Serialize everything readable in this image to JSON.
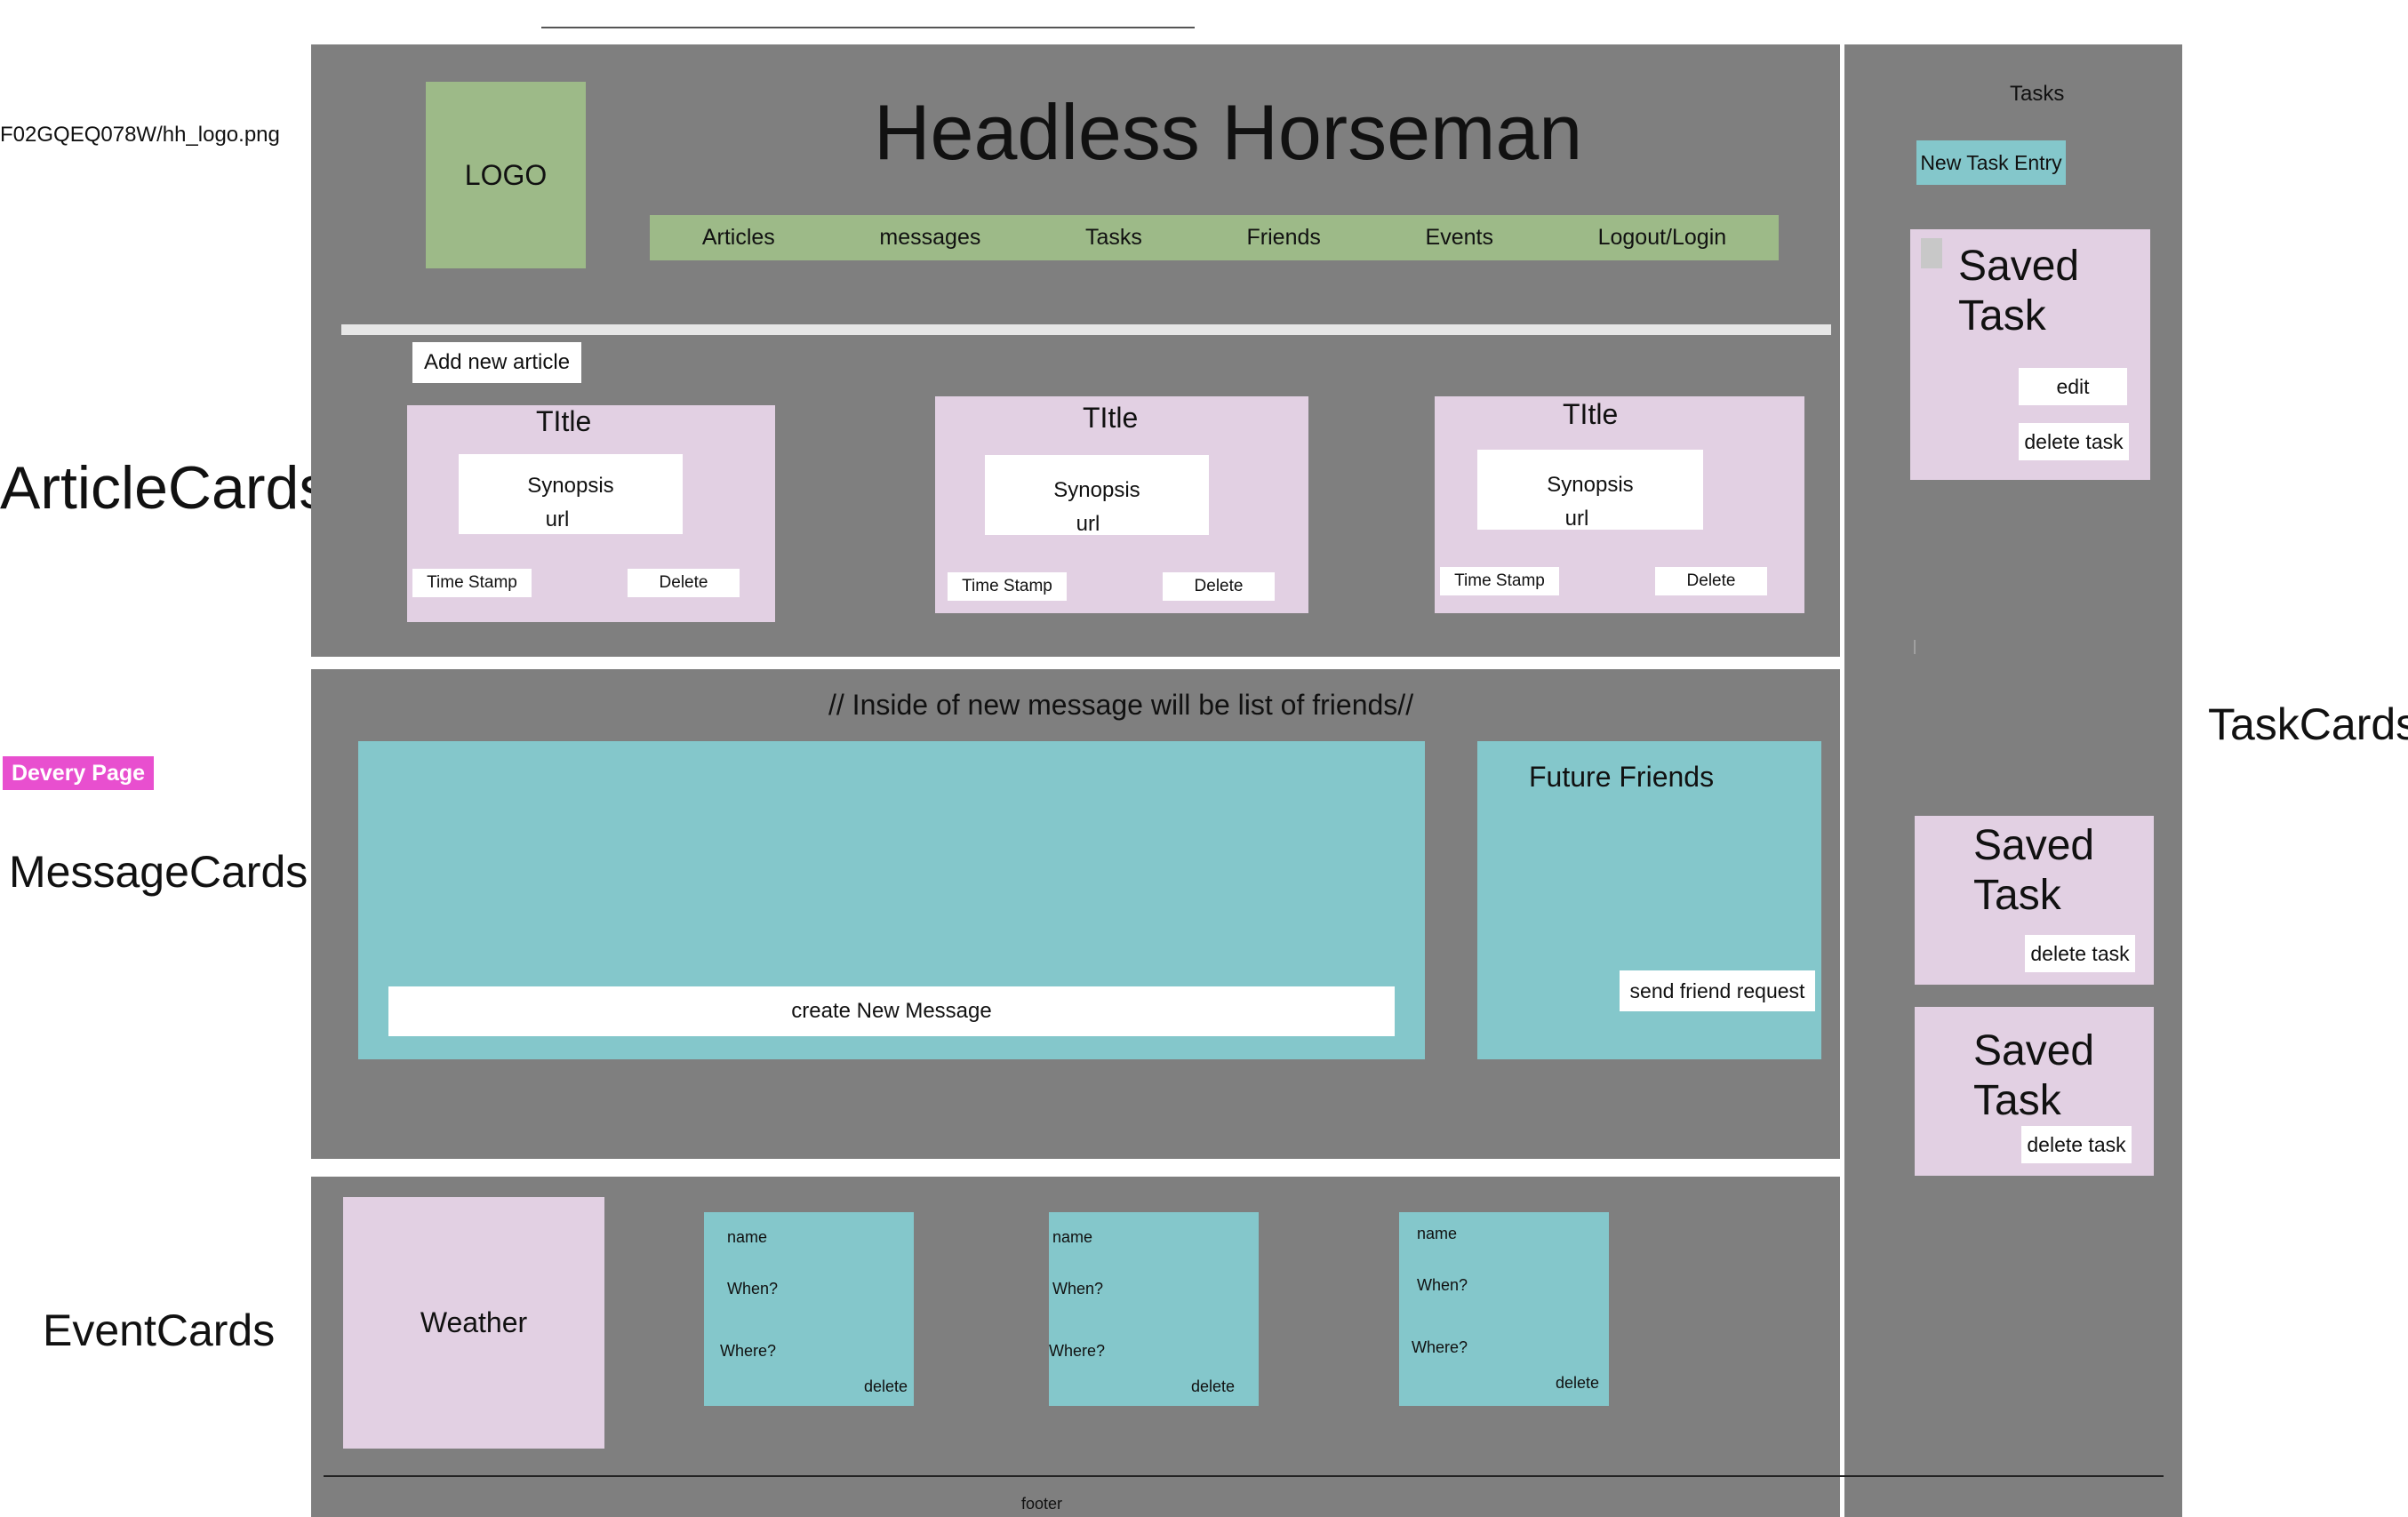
{
  "top_line": "",
  "logo_path": "F02GQEQ078W/hh_logo.png",
  "section_labels": {
    "articles": "ArticleCards",
    "messages": "MessageCards",
    "events": "EventCards",
    "tasks": "TaskCards"
  },
  "badge": "Devery Page",
  "header": {
    "logo": "LOGO",
    "title": "Headless Horseman",
    "nav": [
      "Articles",
      "messages",
      "Tasks",
      "Friends",
      "Events",
      "Logout/Login"
    ]
  },
  "articles": {
    "add_button": "Add new article",
    "cards": [
      {
        "title": "TItle",
        "synopsis": "Synopsis",
        "url": "url",
        "timestamp": "Time Stamp",
        "delete": "Delete"
      },
      {
        "title": "TItle",
        "synopsis": "Synopsis",
        "url": "url",
        "timestamp": "Time Stamp",
        "delete": "Delete"
      },
      {
        "title": "TItle",
        "synopsis": "Synopsis",
        "url": "url",
        "timestamp": "Time Stamp",
        "delete": "Delete"
      }
    ]
  },
  "messages": {
    "note": "// Inside of new message will be list of friends//",
    "create_button": "create New Message",
    "friends_title": "Future Friends",
    "friend_request_button": "send friend request"
  },
  "events": {
    "weather": "Weather",
    "cards": [
      {
        "name": "name",
        "when": "When?",
        "where": "Where?",
        "delete": "delete"
      },
      {
        "name": "name",
        "when": "When?",
        "where": "Where?",
        "delete": "delete"
      },
      {
        "name": "name",
        "when": "When?",
        "where": "Where?",
        "delete": "delete"
      }
    ]
  },
  "footer": "footer",
  "tasks": {
    "heading": "Tasks",
    "new_entry_button": "New Task Entry",
    "cards": [
      {
        "title": "Saved Task",
        "edit": "edit",
        "delete": "delete task"
      },
      {
        "title": "Saved Task",
        "delete": "delete task"
      },
      {
        "title": "Saved Task",
        "delete": "delete task"
      }
    ]
  },
  "colors": {
    "panel": "#7f7f7f",
    "card_pink": "#e2d0e3",
    "card_teal": "#84c7cb",
    "nav_green": "#9dba88",
    "badge_magenta": "#e84fcf",
    "task_button": "#84c7cb"
  }
}
